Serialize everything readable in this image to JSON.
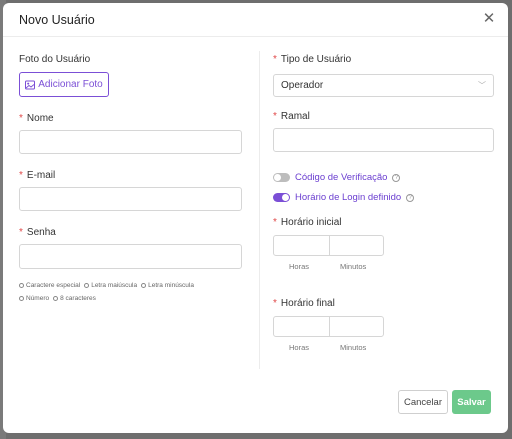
{
  "modal": {
    "title": "Novo Usuário",
    "close_icon": "close-icon"
  },
  "left": {
    "photo_label": "Foto do Usuário",
    "add_photo_label": "Adicionar Foto",
    "add_photo_icon": "image-icon",
    "name_label": "Nome",
    "name_value": "",
    "email_label": "E-mail",
    "email_value": "",
    "password_label": "Senha",
    "password_value": "",
    "password_hints": [
      "Caractere especial",
      "Letra maiúscula",
      "Letra minúscula",
      "Número",
      "8 caracteres"
    ]
  },
  "right": {
    "user_type_label": "Tipo de Usuário",
    "user_type_value": "Operador",
    "extension_label": "Ramal",
    "extension_value": "",
    "verification_code_label": "Código de Verificação",
    "verification_code_enabled": false,
    "login_schedule_label": "Horário de Login definido",
    "login_schedule_enabled": true,
    "start_time_label": "Horário inicial",
    "end_time_label": "Horário final",
    "hours_label": "Horas",
    "minutes_label": "Minutos"
  },
  "footer": {
    "cancel_label": "Cancelar",
    "save_label": "Salvar"
  },
  "colors": {
    "accent": "#7b4fd6",
    "required": "#e04848",
    "save": "#6cc98b"
  }
}
